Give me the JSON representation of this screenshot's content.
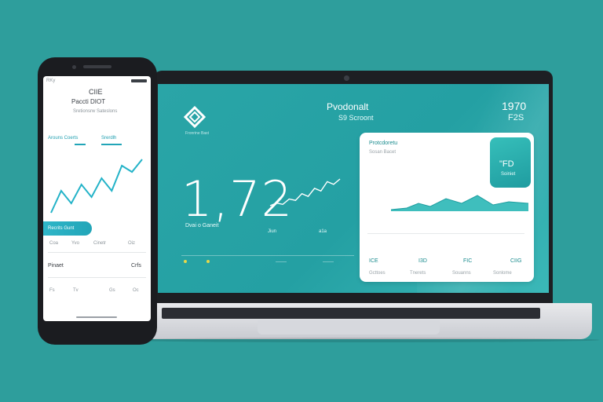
{
  "colors": {
    "background": "#2e9e9c",
    "screen": "#26a2a4",
    "accent": "#22b3c7",
    "card": "#ffffff",
    "highlight": "#e6d84a"
  },
  "laptop": {
    "header_title": "Pvodonalt",
    "header_sub": "S9 Scroont",
    "top_right_number": "1970",
    "top_right_sub": "F2S",
    "logo_caption": "Fronrine Bast",
    "main_value": "1,72",
    "sub_label": "Dvai o Ganeit",
    "small_label_1": "Jiun",
    "small_label_2": "a1a",
    "card": {
      "title": "Protcdoretu",
      "subtitle": "Sosan Bacet",
      "hilite_value": "\"FD",
      "hilite_label": "Soiniet",
      "stats": [
        "ICE",
        "I3D",
        "FIC",
        "CIIG"
      ],
      "footer": [
        "Gcttoes",
        "Tnerets",
        "Souanns",
        "Sonlome"
      ]
    },
    "sparkline": [
      4,
      6,
      5,
      9,
      8,
      13,
      11,
      17,
      15,
      22,
      20,
      24
    ]
  },
  "phone": {
    "status_time": "RKy",
    "title": "CIIE",
    "subtitle": "Paccti DIOT",
    "caption": "Sretionsrw Sateslons",
    "tab_left": "Arouns Coerts",
    "tab_right": "Srerdlh",
    "banner_text": "Recrits Gunt",
    "row_a": [
      "Coa",
      "Yvo",
      "Cinetr",
      "Oiz"
    ],
    "row_b_label": "Pinaet",
    "row_b_value": "Crfs",
    "row_c": [
      "Fs",
      "Tv",
      "Gs",
      "Oc"
    ],
    "chart": [
      3,
      10,
      6,
      12,
      8,
      14,
      10,
      18,
      16,
      20
    ]
  }
}
